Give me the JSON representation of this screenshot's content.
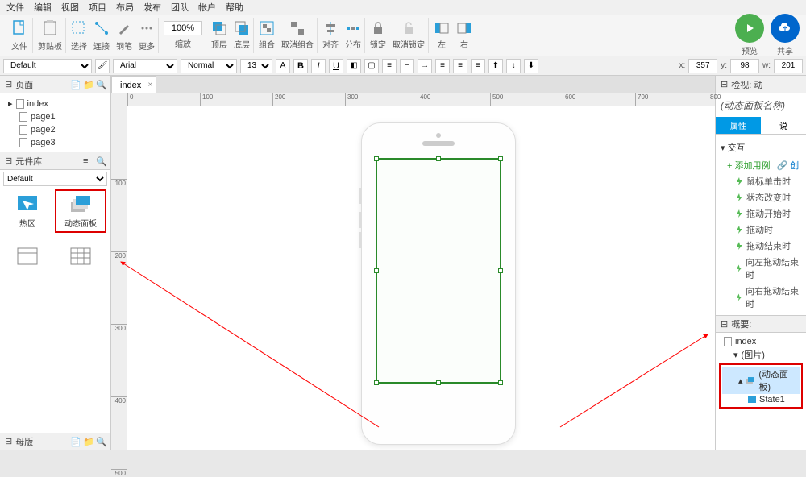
{
  "menu": [
    "文件",
    "编辑",
    "视图",
    "项目",
    "布局",
    "发布",
    "团队",
    "帐户",
    "帮助"
  ],
  "toolbar": {
    "file_label": "文件",
    "clipboard_label": "剪贴板",
    "select_label": "选择",
    "connect_label": "连接",
    "pen_label": "钢笔",
    "more_label": "更多",
    "zoom_value": "100%",
    "zoom_label": "缩放",
    "front_label": "顶层",
    "back_label": "底层",
    "group_label": "组合",
    "ungroup_label": "取消组合",
    "align_label": "对齐",
    "distribute_label": "分布",
    "lock_label": "锁定",
    "unlock_label": "取消锁定",
    "left_label": "左",
    "right_label": "右",
    "preview_label": "预览",
    "share_label": "共享"
  },
  "propbar": {
    "preset": "Default",
    "font": "Arial",
    "weight": "Normal",
    "size": "13",
    "x_label": "x:",
    "x_value": "357",
    "y_label": "y:",
    "y_value": "98",
    "w_label": "w:",
    "w_value": "201"
  },
  "left": {
    "pages_title": "页面",
    "pages": [
      "index",
      "page1",
      "page2",
      "page3"
    ],
    "widgets_title": "元件库",
    "widget_lib_select": "Default",
    "widget_hotspot": "热区",
    "widget_dynamic_panel": "动态面板",
    "masters_title": "母版"
  },
  "canvas": {
    "tab_name": "index",
    "ruler_h": [
      "0",
      "100",
      "200",
      "300",
      "400",
      "500",
      "600",
      "700",
      "800"
    ],
    "ruler_v": [
      "100",
      "200",
      "300",
      "400",
      "500"
    ]
  },
  "right": {
    "inspector_title": "检视: 动",
    "panel_name_placeholder": "(动态面板名称)",
    "tab_props": "属性",
    "tab_notes": "说",
    "interactions_title": "交互",
    "add_case": "添加用例",
    "add_link": "创",
    "events": [
      "鼠标单击时",
      "状态改变时",
      "拖动开始时",
      "拖动时",
      "拖动结束时",
      "向左拖动结束时",
      "向右拖动结束时"
    ],
    "outline_title": "概要:",
    "outline": {
      "root": "index",
      "image": "(图片)",
      "dp": "(动态面板)",
      "state": "State1"
    }
  }
}
